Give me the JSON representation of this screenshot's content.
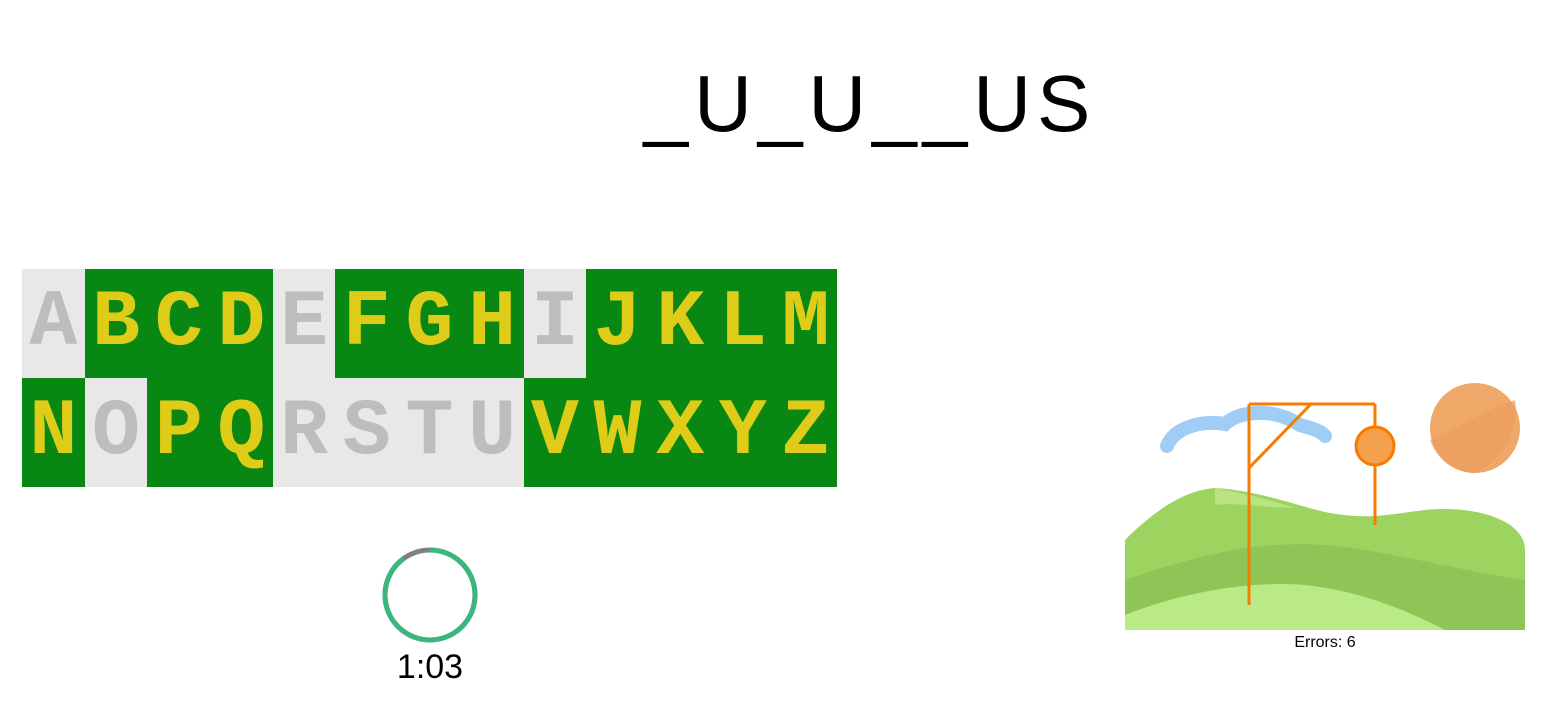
{
  "word_display": "_U_U__US",
  "keyboard": {
    "keys": [
      {
        "letter": "A",
        "state": "used"
      },
      {
        "letter": "B",
        "state": "available"
      },
      {
        "letter": "C",
        "state": "available"
      },
      {
        "letter": "D",
        "state": "available"
      },
      {
        "letter": "E",
        "state": "used"
      },
      {
        "letter": "F",
        "state": "available"
      },
      {
        "letter": "G",
        "state": "available"
      },
      {
        "letter": "H",
        "state": "available"
      },
      {
        "letter": "I",
        "state": "used"
      },
      {
        "letter": "J",
        "state": "available"
      },
      {
        "letter": "K",
        "state": "available"
      },
      {
        "letter": "L",
        "state": "available"
      },
      {
        "letter": "M",
        "state": "available"
      },
      {
        "letter": "N",
        "state": "available"
      },
      {
        "letter": "O",
        "state": "used"
      },
      {
        "letter": "P",
        "state": "available"
      },
      {
        "letter": "Q",
        "state": "available"
      },
      {
        "letter": "R",
        "state": "used"
      },
      {
        "letter": "S",
        "state": "used"
      },
      {
        "letter": "T",
        "state": "used"
      },
      {
        "letter": "U",
        "state": "used"
      },
      {
        "letter": "V",
        "state": "available"
      },
      {
        "letter": "W",
        "state": "available"
      },
      {
        "letter": "X",
        "state": "available"
      },
      {
        "letter": "Y",
        "state": "available"
      },
      {
        "letter": "Z",
        "state": "available"
      }
    ],
    "colors": {
      "available_bg": "#088712",
      "available_text": "#dfcc18",
      "used_bg": "#e8e8e8",
      "used_text": "#bdbdbd"
    }
  },
  "timer": {
    "text": "1:03",
    "remaining_fraction": 0.9,
    "ring_color": "#3bb77e",
    "track_color": "#808080"
  },
  "status": {
    "errors_text": "Errors: 6"
  },
  "hangman_scene": {
    "icon": "hangman-landscape-illustration",
    "gallows_color": "#f57c00",
    "sun_color": "#f0a868",
    "cloud_color": "#a0cdf5",
    "hill_color": "#9dd35f"
  }
}
